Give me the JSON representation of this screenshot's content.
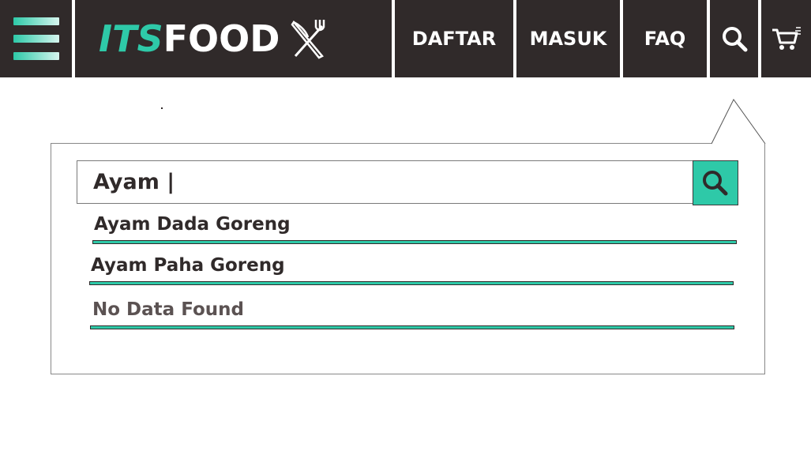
{
  "header": {
    "menu_icon": "hamburger-icon",
    "logo": {
      "part1": "ITS",
      "part2": "FOOD",
      "icon": "fork-knife-icon"
    },
    "nav": {
      "daftar": "DAFTAR",
      "masuk": "MASUK",
      "faq": "FAQ"
    },
    "search_icon": "search-icon",
    "cart_icon": "cart-icon"
  },
  "search": {
    "value": "Ayam |",
    "button_icon": "search-icon",
    "results": [
      {
        "label": "Ayam Dada Goreng"
      },
      {
        "label": "Ayam Paha Goreng"
      },
      {
        "label": "No Data Found"
      }
    ]
  },
  "colors": {
    "bar": "#302a2a",
    "accent": "#2ec9a8",
    "white": "#ffffff"
  }
}
